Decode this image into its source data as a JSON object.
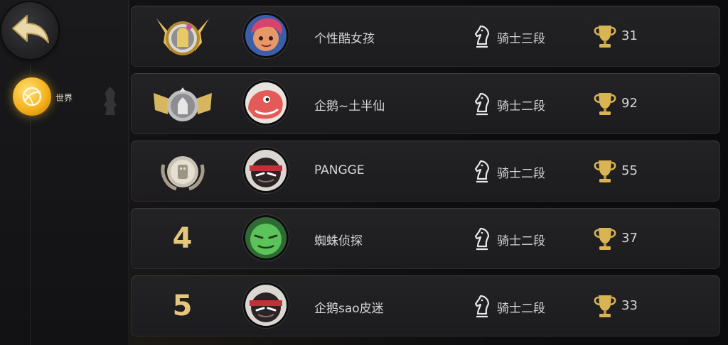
{
  "nav": {
    "back_icon": "back-arrow-icon",
    "tab_label": "世界",
    "tab_icon": "globe-icon"
  },
  "rows": [
    {
      "rank": "1",
      "rank_badge": "gold-laurel-badge-icon",
      "avatar_color": "#c04d6e",
      "name": "个性酷女孩",
      "tier": "骑士三段",
      "score": "31"
    },
    {
      "rank": "2",
      "rank_badge": "silver-winged-badge-icon",
      "avatar_color": "#e65a5a",
      "name": "企鹅~土半仙",
      "tier": "骑士二段",
      "score": "92"
    },
    {
      "rank": "3",
      "rank_badge": "bronze-round-badge-icon",
      "avatar_color": "#3b2b2b",
      "name": "PANGGE",
      "tier": "骑士二段",
      "score": "55"
    },
    {
      "rank": "4",
      "rank_badge": "",
      "avatar_color": "#3fae4a",
      "name": "蜘蛛侦探",
      "tier": "骑士二段",
      "score": "37"
    },
    {
      "rank": "5",
      "rank_badge": "",
      "avatar_color": "#3b2b2b",
      "name": "企鹅sao皮迷",
      "tier": "骑士二段",
      "score": "33"
    }
  ],
  "colors": {
    "gold": "#e6c67a",
    "text": "#d5d5d8",
    "row_bg": "#1f1f22"
  }
}
